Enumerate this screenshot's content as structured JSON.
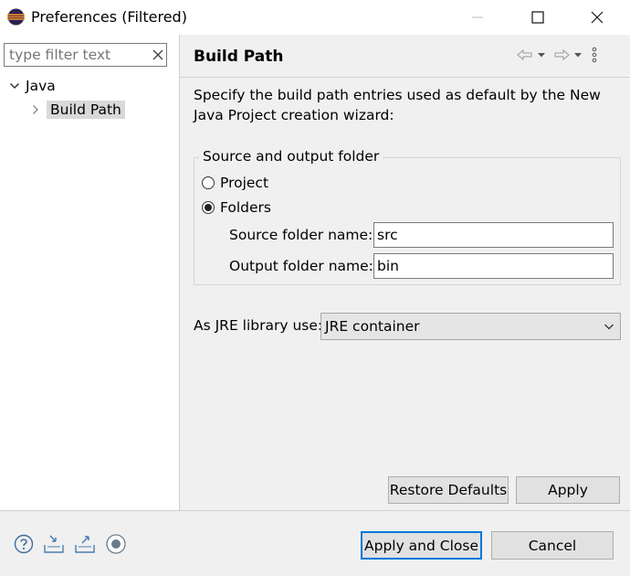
{
  "window": {
    "title": "Preferences (Filtered)",
    "icons": {
      "app": "eclipse-icon",
      "minimize": "minimize-icon",
      "maximize": "maximize-icon",
      "close": "close-icon"
    }
  },
  "sidebar": {
    "filter_placeholder": "type filter text",
    "filter_value": "",
    "tree": {
      "java_label": "Java",
      "build_path_label": "Build Path"
    }
  },
  "page": {
    "title": "Build Path",
    "description": "Specify the build path entries used as default by the New Java Project creation wizard:",
    "group": {
      "legend": "Source and output folder",
      "radio_project": "Project",
      "radio_folders": "Folders",
      "selected": "Folders",
      "source_label": "Source folder name:",
      "source_value": "src",
      "output_label": "Output folder name:",
      "output_value": "bin"
    },
    "jre": {
      "label": "As JRE library use:",
      "selected": "JRE container"
    },
    "buttons": {
      "restore_defaults": "Restore Defaults",
      "apply": "Apply"
    }
  },
  "footer": {
    "apply_and_close": "Apply and Close",
    "cancel": "Cancel",
    "icons": [
      "help-icon",
      "import-icon",
      "export-icon",
      "record-icon"
    ]
  },
  "colors": {
    "default_button_border": "#0078d7",
    "tree_selection": "#d9d9d9"
  }
}
